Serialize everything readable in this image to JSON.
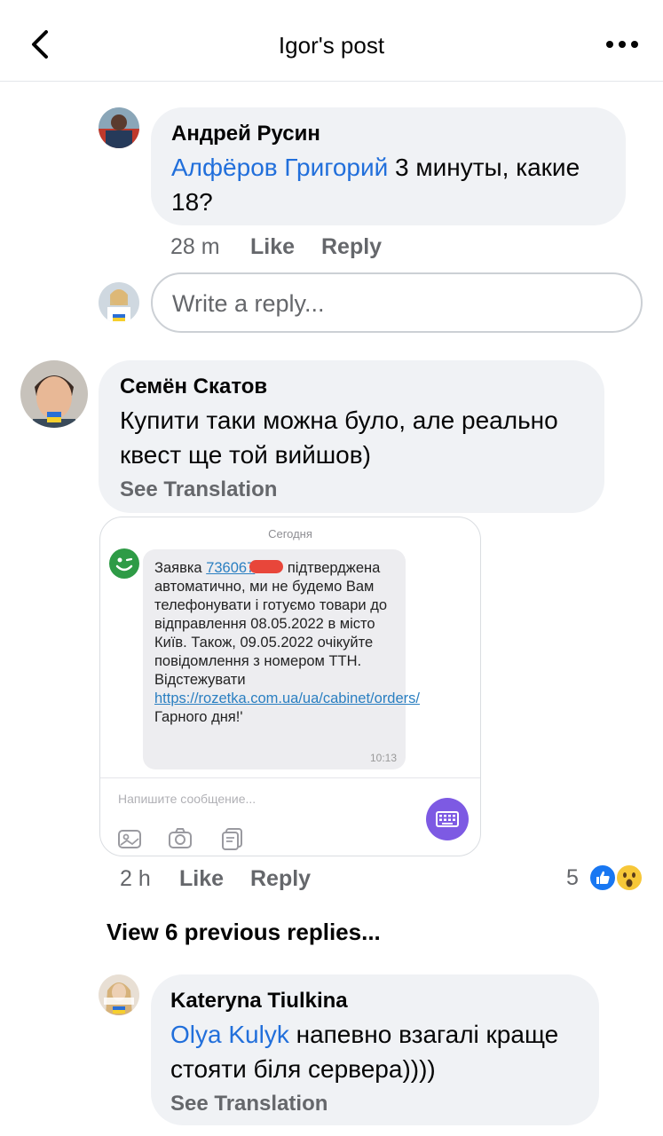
{
  "header": {
    "title": "Igor's post",
    "back_icon": "back-chevron-icon",
    "more_icon": "more-options-icon"
  },
  "comments": [
    {
      "author": "Андрей Русин",
      "mention": "Алфёров Григорий",
      "text_line1": " 3 минуты, какие",
      "text_line2": "18?",
      "time": "28 m",
      "like": "Like",
      "reply": "Reply"
    },
    {
      "author": "Семён Скатов",
      "text_line1": "Купити таки можна було, але реально",
      "text_line2": "квест ще той вийшов)",
      "see_translation": "See Translation",
      "time": "2 h",
      "like": "Like",
      "reply": "Reply",
      "reaction_count": "5",
      "reaction_icons": [
        "like-reaction-icon",
        "wow-reaction-icon"
      ]
    },
    {
      "author": "Kateryna  Tiulkina",
      "mention": "Olya Kulyk",
      "text_line1": " напевно взагалі краще",
      "text_line2": "стояти біля сервера))))",
      "see_translation": "See Translation"
    }
  ],
  "reply_box": {
    "placeholder": "Write a reply..."
  },
  "attachment": {
    "date": "Сегодня",
    "msg_prefix": "Заявка ",
    "msg_order": "736067",
    "msg_body": "підтверджена автоматично, ми не будемо Вам телефонувати і готуємо товари до відправлення 08.05.2022 в місто Київ. Також, 09.05.2022 очікуйте повідомлення з номером ТТН.  Відстежувати ",
    "msg_link": "https://rozetka.com.ua/ua/cabinet/orders/",
    "msg_suffix": " Гарного дня!'",
    "msg_time": "10:13",
    "input_placeholder": "Напишите сообщение..."
  },
  "view_previous": "View 6 previous replies...",
  "colors": {
    "bubble": "#f0f2f5",
    "mention": "#216fdb",
    "secondary_text": "#65676b",
    "keyboard_button": "#7d5ae3"
  }
}
